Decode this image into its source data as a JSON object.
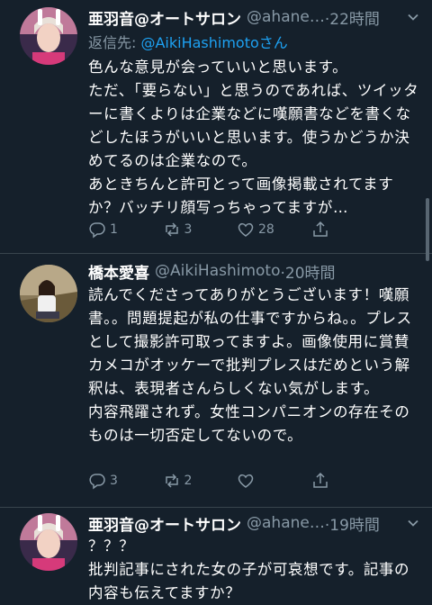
{
  "colors": {
    "background": "#15202b",
    "text": "#ffffff",
    "muted": "#8899a6",
    "link": "#1da1f2",
    "divider": "#38444d"
  },
  "tweets": [
    {
      "name": "亜羽音@オートサロン",
      "handle": "@ahane…",
      "time": "·22時間",
      "reply_label": "返信先: ",
      "reply_link": "@AikiHashimotoさん",
      "body": [
        "色んな意見が会っていいと思います。",
        "ただ、「要らない」と思うのであれば、ツイッターに書くよりは企業などに嘆願書などを書くなどしたほうがいいと思います。使うかどうか決めてるのは企業なので。",
        "あときちんと許可とって画像掲載されてますか？バッチリ顔写っちゃってますが…"
      ],
      "reply_count": "1",
      "retweet_count": "3",
      "like_count": "28",
      "share_count": ""
    },
    {
      "name": "橋本愛喜",
      "handle": "@AikiHashimoto",
      "time": "·20時間",
      "body": [
        "読んでくださってありがとうございます！嘆願書。。問題提起が私の仕事ですからね。。プレスとして撮影許可取ってますよ。画像使用に賞賛カメコがオッケーで批判プレスはだめという解釈は、表現者さんらしくない気がします。",
        "内容飛躍されず。女性コンパニオンの存在そのものは一切否定してないので。"
      ],
      "reply_count": "3",
      "retweet_count": "2",
      "like_count": "",
      "share_count": ""
    },
    {
      "name": "亜羽音@オートサロン",
      "handle": "@ahane…",
      "time": "·19時間",
      "body": [
        "？？？",
        "批判記事にされた女の子が可哀想です。記事の内容も伝えてますか？"
      ]
    }
  ]
}
